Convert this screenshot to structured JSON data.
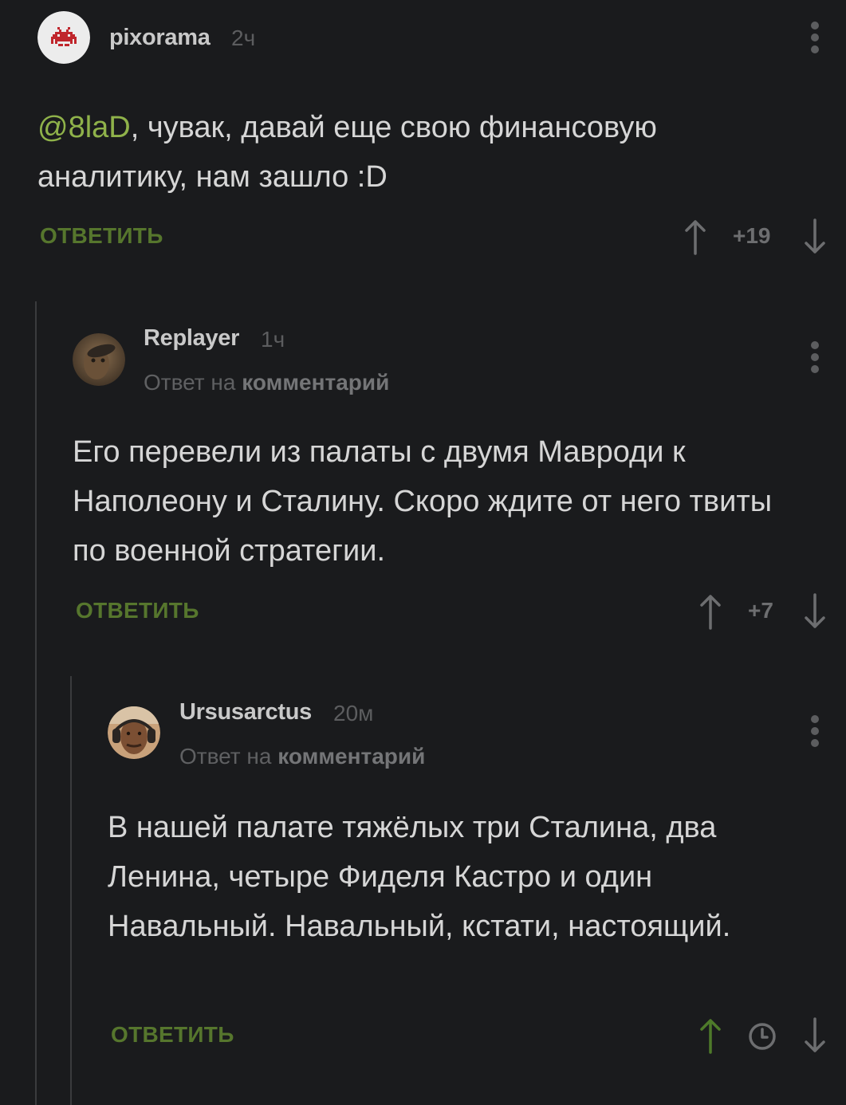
{
  "comments": [
    {
      "username": "pixorama",
      "time": "2ч",
      "mention": "@8laD",
      "text": ", чувак, давай еще свою финансовую аналитику, нам зашло :D",
      "reply_label": "ОТВЕТИТЬ",
      "rating": "+19"
    },
    {
      "username": "Replayer",
      "time": "1ч",
      "reply_to_prefix": "Ответ на",
      "reply_to_link": "комментарий",
      "text": "Его перевели из палаты с двумя Мавроди к Наполеону и Сталину. Скоро ждите от него твиты по военной стратегии.",
      "reply_label": "ОТВЕТИТЬ",
      "rating": "+7"
    },
    {
      "username": "Ursusarctus",
      "time": "20м",
      "reply_to_prefix": "Ответ на",
      "reply_to_link": "комментарий",
      "text": "В нашей палате тяжёлых три Сталина, два Ленина, четыре Фиделя Кастро и один Навальный. Навальный, кстати, настоящий.",
      "reply_label": "ОТВЕТИТЬ",
      "rating_icon": "clock-icon"
    }
  ],
  "colors": {
    "background": "#1a1b1d",
    "accent_green": "#56762d",
    "mention_green": "#8fb24a",
    "upvoted_green": "#4e7a2a"
  }
}
